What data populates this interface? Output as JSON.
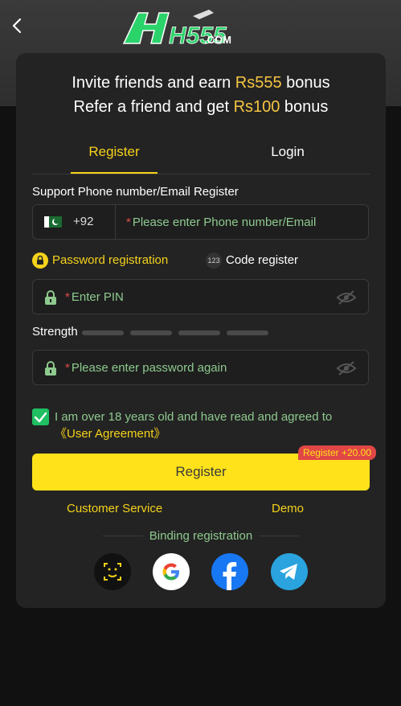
{
  "header": {
    "logo_text": "H555",
    "logo_suffix": ".COM"
  },
  "invite": {
    "line1_pre": "Invite friends and earn ",
    "line1_amount": "Rs555",
    "line1_post": " bonus",
    "line2_pre": "Refer a friend and get ",
    "line2_amount": "Rs100",
    "line2_post": " bonus"
  },
  "tabs": {
    "register": "Register",
    "login": "Login"
  },
  "phone": {
    "label": "Support Phone number/Email Register",
    "country_code": "+92",
    "placeholder": "Please enter Phone number/Email"
  },
  "modes": {
    "password": "Password registration",
    "code_icon": "123",
    "code": "Code register"
  },
  "pin": {
    "placeholder": "Enter PIN"
  },
  "strength": {
    "label": "Strength"
  },
  "confirm": {
    "placeholder": "Please enter password again"
  },
  "agreement": {
    "text": "I am over 18 years old and have read and agreed to ",
    "link": "《User Agreement》",
    "checked": true
  },
  "register_button": {
    "label": "Register",
    "badge": "Register +20.00"
  },
  "links": {
    "customer_service": "Customer Service",
    "demo": "Demo"
  },
  "binding": {
    "label": "Binding registration",
    "providers": [
      "face-id",
      "google",
      "facebook",
      "telegram"
    ]
  },
  "colors": {
    "accent": "#f5d21b",
    "placeholder": "#8ec98e",
    "check": "#1fbf62",
    "card": "#232323"
  }
}
